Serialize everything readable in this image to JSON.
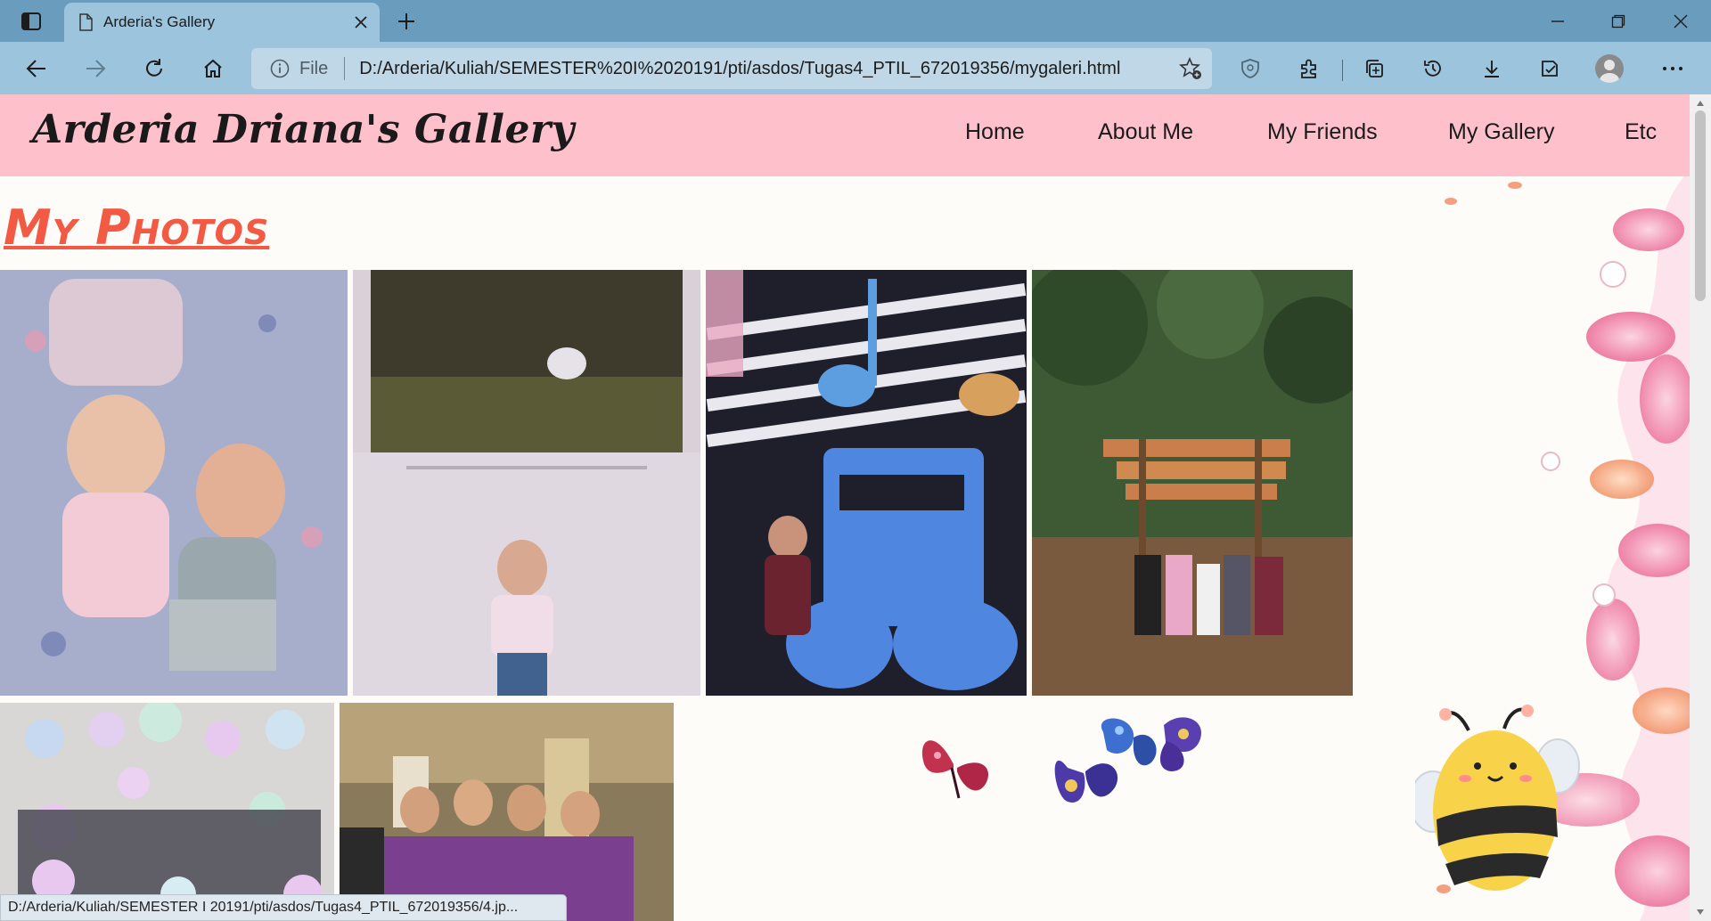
{
  "browser": {
    "tab_title": "Arderia's Gallery",
    "address_scheme": "File",
    "address_url": "D:/Arderia/Kuliah/SEMESTER%20I%2020191/pti/asdos/Tugas4_PTIL_672019356/mygaleri.html",
    "status_text": "D:/Arderia/Kuliah/SEMESTER I 20191/pti/asdos/Tugas4_PTIL_672019356/4.jp..."
  },
  "site": {
    "title": "Arderia Driana's Gallery",
    "nav": [
      "Home",
      "About Me",
      "My Friends",
      "My Gallery",
      "Etc"
    ]
  },
  "main": {
    "heading": "My Photos"
  },
  "colors": {
    "header_bg": "#fec1cc",
    "heading": "#f25a44",
    "tabbar": "#6a9cbd",
    "toolbar": "#9cc4dc"
  }
}
